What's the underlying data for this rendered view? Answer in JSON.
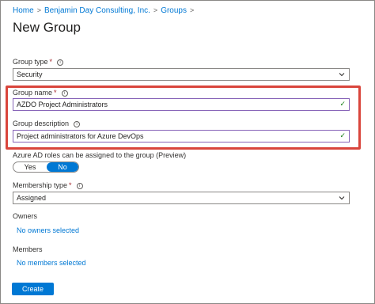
{
  "breadcrumb": {
    "items": [
      "Home",
      "Benjamin Day Consulting, Inc.",
      "Groups"
    ]
  },
  "page": {
    "title": "New Group"
  },
  "group_type": {
    "label": "Group type",
    "value": "Security"
  },
  "group_name": {
    "label": "Group name",
    "value": "AZDO Project Administrators"
  },
  "group_description": {
    "label": "Group description",
    "value": "Project administrators for Azure DevOps"
  },
  "azure_ad_roles": {
    "label": "Azure AD roles can be assigned to the group (Preview)",
    "yes": "Yes",
    "no": "No",
    "selected": "No"
  },
  "membership_type": {
    "label": "Membership type",
    "value": "Assigned"
  },
  "owners": {
    "label": "Owners",
    "link": "No owners selected"
  },
  "members": {
    "label": "Members",
    "link": "No members selected"
  },
  "actions": {
    "create": "Create"
  },
  "colors": {
    "accent": "#0078d4",
    "highlight": "#d9453c",
    "valid": "#107c10"
  }
}
